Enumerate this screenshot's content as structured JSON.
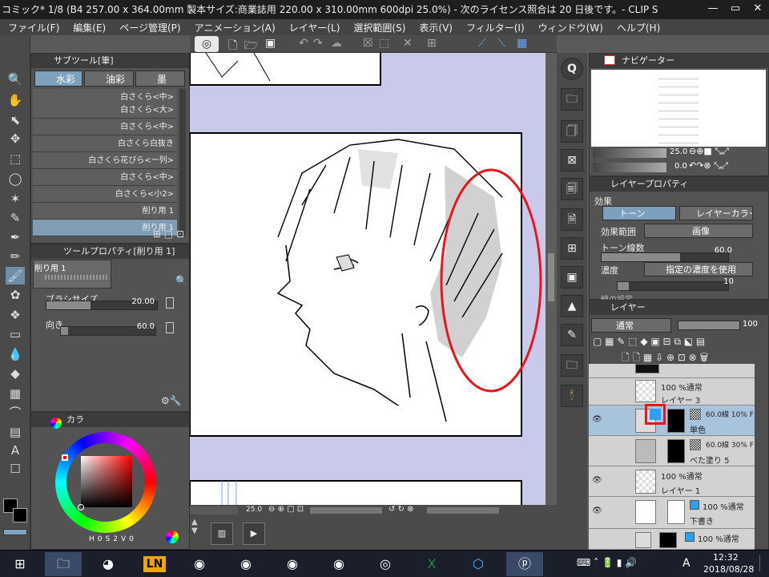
{
  "window": {
    "title": "コミック* 1/8 (B4 257.00 x 364.00mm 製本サイズ:商業誌用 220.00 x 310.00mm 600dpi 25.0%) - 次のライセンス照合は 20 日後です。- CLIP S",
    "minimize": "—",
    "maximize": "▭",
    "close": "✕"
  },
  "menu": [
    "ファイル(F)",
    "編集(E)",
    "ページ管理(P)",
    "アニメーション(A)",
    "レイヤー(L)",
    "選択範囲(S)",
    "表示(V)",
    "フィルター(I)",
    "ウィンドウ(W)",
    "ヘルプ(H)"
  ],
  "subtool": {
    "title": "サブツール[筆]",
    "tabs": [
      "水彩",
      "油彩",
      "墨"
    ],
    "selected_tab": 0,
    "brushes": [
      "白さくら<中>",
      "白さくら<大>",
      "白さくら<中>",
      "白さくら白抜き",
      "白さくら花びら<ー列>",
      "白さくら<中>",
      "白さくら<小2>",
      "削り用 1",
      "削り用 1"
    ],
    "selected_brush": 8
  },
  "toolprop": {
    "title": "ツールプロパティ[削り用 1]",
    "preview_label": "削り用 1",
    "brush_size_label": "ブラシサイズ",
    "brush_size_value": "20.00",
    "direction_label": "向き",
    "direction_value": "60.0"
  },
  "color": {
    "title": "カラ",
    "hsv": {
      "h_label": "H",
      "h": "0",
      "s_label": "S",
      "s": "2",
      "v_label": "V",
      "v": "0"
    },
    "main_color": "#000000",
    "sub_color": "#000000"
  },
  "canvas": {
    "zoom": "25.0",
    "paper_color": "#c9c9eb"
  },
  "navigator": {
    "title": "ナビゲーター",
    "zoom": "25.0",
    "angle": "0.0"
  },
  "layerprop": {
    "title": "レイヤープロパティ",
    "effect_label": "効果",
    "tone_label": "トーン",
    "layer_color_label": "レイヤーカラー",
    "effect_range_label": "効果範囲",
    "effect_range_value": "画像",
    "tone_lines_label": "トーン線数",
    "tone_lines_value": "60.0",
    "density_label": "濃度",
    "density_value": "指定の濃度を使用",
    "density_number": "10",
    "extra_label": "線の設定"
  },
  "layers": {
    "title": "レイヤー",
    "blend_mode": "通常",
    "opacity": "100",
    "items": [
      {
        "mode": "100 %通常",
        "name": "レイヤー 3",
        "tone": "",
        "selected": false
      },
      {
        "mode": "",
        "name": "単色",
        "tone": "60.0線 10% F",
        "selected": true
      },
      {
        "mode": "",
        "name": "べた塗り 5",
        "tone": "60.0線 30% F",
        "selected": false
      },
      {
        "mode": "100 %通常",
        "name": "レイヤー 1",
        "tone": "",
        "selected": false
      },
      {
        "mode": "100 %通常",
        "name": "下書き",
        "tone": "",
        "selected": false
      },
      {
        "mode": "100 %通常",
        "name": "",
        "tone": "",
        "selected": false
      }
    ]
  },
  "taskbar": {
    "apps": [
      "windows-start",
      "file-explorer",
      "media-player",
      "LN",
      "chrome",
      "chrome",
      "chrome",
      "chrome",
      "clip-studio",
      "excel",
      "3d-app",
      "clip-studio-paint"
    ],
    "ln_label": "LN",
    "time": "12:32",
    "date": "2018/08/28",
    "ime": "A"
  },
  "annotation_color": "#e8151b"
}
